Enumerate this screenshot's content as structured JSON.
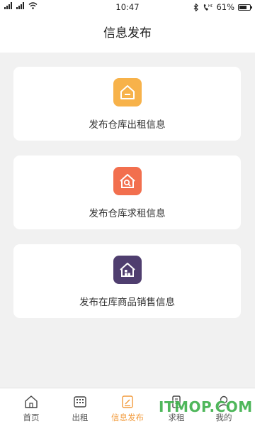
{
  "status_bar": {
    "time": "10:47",
    "battery": "61%",
    "icons": [
      "signal-icon",
      "signal-icon",
      "wifi-icon",
      "bluetooth-icon",
      "call-hd-icon",
      "battery-icon"
    ]
  },
  "header": {
    "title": "信息发布"
  },
  "cards": [
    {
      "label": "发布仓库出租信息",
      "icon": "house-icon",
      "color": "#f7b24a"
    },
    {
      "label": "发布仓库求租信息",
      "icon": "house-search-icon",
      "color": "#f26f4e"
    },
    {
      "label": "发布在库商品销售信息",
      "icon": "house-goods-icon",
      "color": "#4f3e6f"
    }
  ],
  "tabs": [
    {
      "label": "首页",
      "icon": "home-icon"
    },
    {
      "label": "出租",
      "icon": "rent-out-icon"
    },
    {
      "label": "信息发布",
      "icon": "publish-icon",
      "active": true
    },
    {
      "label": "求租",
      "icon": "building-icon"
    },
    {
      "label": "我的",
      "icon": "user-icon"
    }
  ],
  "colors": {
    "accent": "#f29a3b"
  },
  "watermark": {
    "text": "ITMOP.COM"
  }
}
